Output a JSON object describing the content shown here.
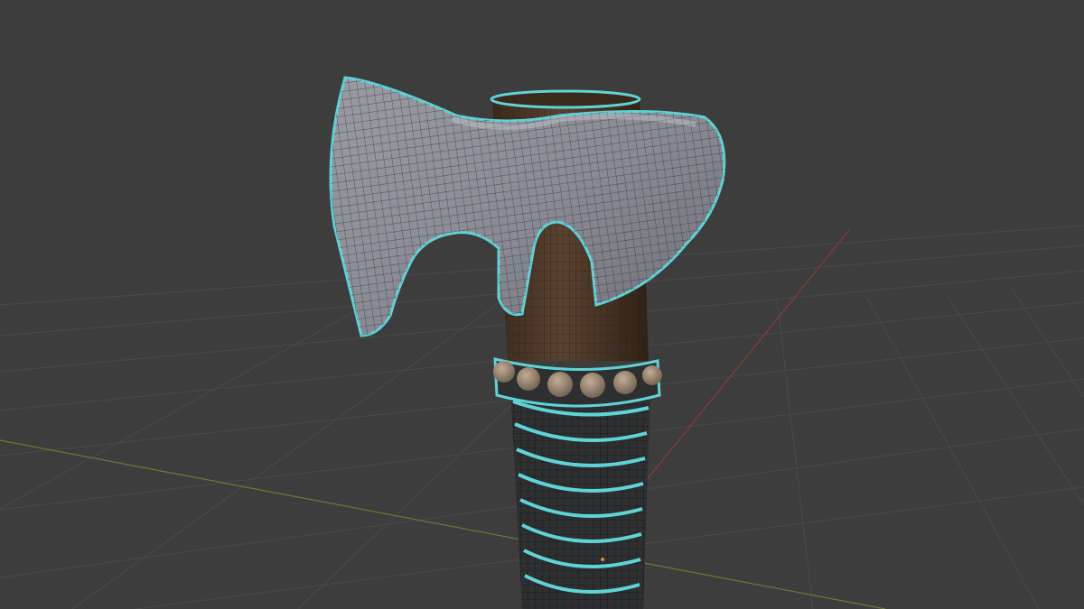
{
  "viewport": {
    "background_color": "#3d3d3d",
    "grid_color": "#4a4a4a",
    "x_axis_color": "#8c3a3a",
    "y_axis_color": "#6f7a2c",
    "selection_outline_color": "#5fd3d6"
  },
  "object": {
    "name_icon": "axe-model-icon",
    "blade_color": "#8e8f97",
    "handle_color": "#4a3526",
    "grip_color": "#2e2f31",
    "stud_color": "#a38e78"
  }
}
